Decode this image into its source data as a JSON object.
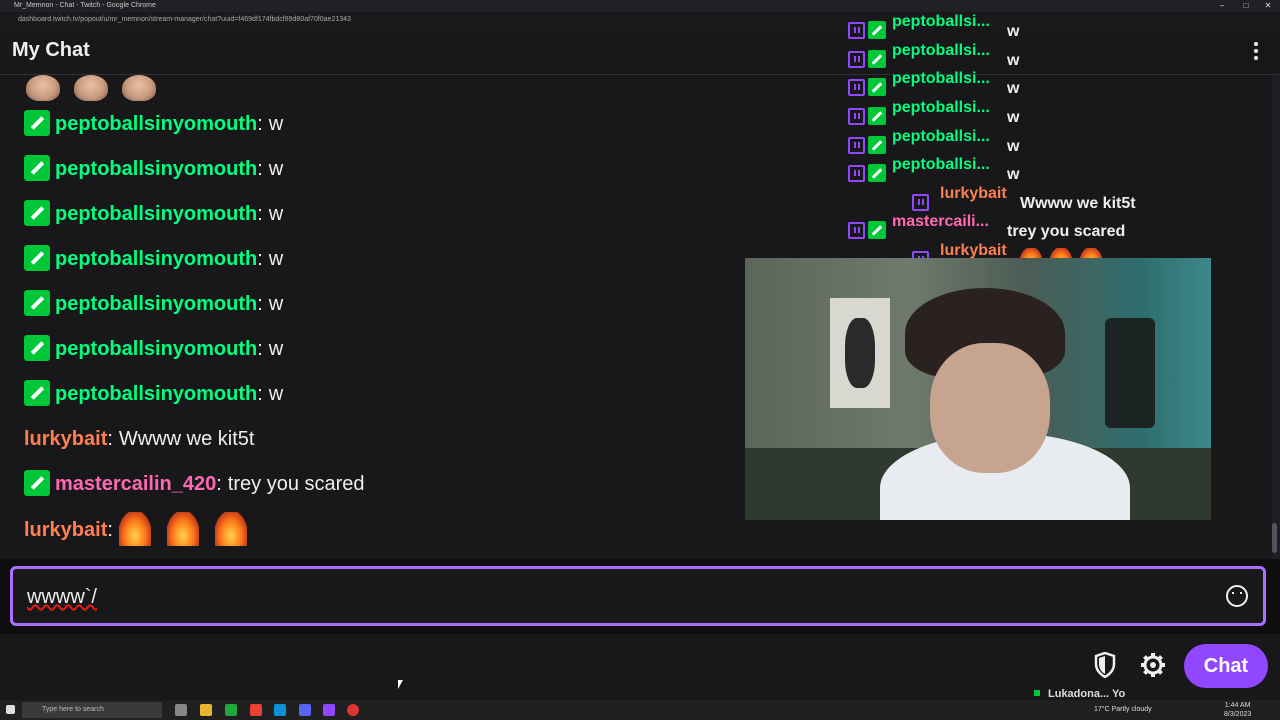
{
  "window": {
    "title": "Mr_Memnon - Chat - Twitch - Google Chrome",
    "url": "dashboard.twitch.tv/popout/u/mr_memnon/stream-manager/chat?uuid=f469df174fbdcf89d80af70f0ae21343"
  },
  "header": {
    "title": "My Chat"
  },
  "chat": {
    "messages": [
      {
        "user": "peptoballsinyomouth",
        "text": "w",
        "color": "#00ff7f",
        "badge": true
      },
      {
        "user": "peptoballsinyomouth",
        "text": "w",
        "color": "#00ff7f",
        "badge": true
      },
      {
        "user": "peptoballsinyomouth",
        "text": "w",
        "color": "#00ff7f",
        "badge": true
      },
      {
        "user": "peptoballsinyomouth",
        "text": "w",
        "color": "#00ff7f",
        "badge": true
      },
      {
        "user": "peptoballsinyomouth",
        "text": "w",
        "color": "#00ff7f",
        "badge": true
      },
      {
        "user": "peptoballsinyomouth",
        "text": "w",
        "color": "#00ff7f",
        "badge": true
      },
      {
        "user": "peptoballsinyomouth",
        "text": "w",
        "color": "#00ff7f",
        "badge": true
      },
      {
        "user": "lurkybait",
        "text": "Wwww we kit5t",
        "color": "#ff7f50",
        "badge": false
      },
      {
        "user": "mastercailin_420",
        "text": "trey you scared",
        "color": "#ff69b4",
        "badge": true
      },
      {
        "user": "lurkybait",
        "text": "",
        "color": "#ff7f50",
        "badge": false,
        "emotes": "fire"
      }
    ],
    "separator": ":"
  },
  "overlay": {
    "messages": [
      {
        "user": "peptoballsi...",
        "text": "w"
      },
      {
        "user": "peptoballsi...",
        "text": "w"
      },
      {
        "user": "peptoballsi...",
        "text": "w"
      },
      {
        "user": "peptoballsi...",
        "text": "w"
      },
      {
        "user": "peptoballsi...",
        "text": "w"
      },
      {
        "user": "peptoballsi...",
        "text": "w"
      },
      {
        "user": "lurkybait",
        "text": "Wwww we kit5t"
      },
      {
        "user": "mastercaili...",
        "text": "trey you scared"
      },
      {
        "user": "lurkybait",
        "text": ""
      }
    ]
  },
  "input": {
    "value": "wwww`/"
  },
  "controls": {
    "chat_button": "Chat"
  },
  "mini_chat": {
    "user": "Lukadona...",
    "text": "Yo"
  },
  "taskbar": {
    "search_placeholder": "Type here to search",
    "weather": "17°C  Partly cloudy",
    "time": "1:44 AM",
    "date": "8/3/2023"
  },
  "colors": {
    "accent": "#9147ff",
    "focus": "#a970ff",
    "badge": "#00c738"
  }
}
